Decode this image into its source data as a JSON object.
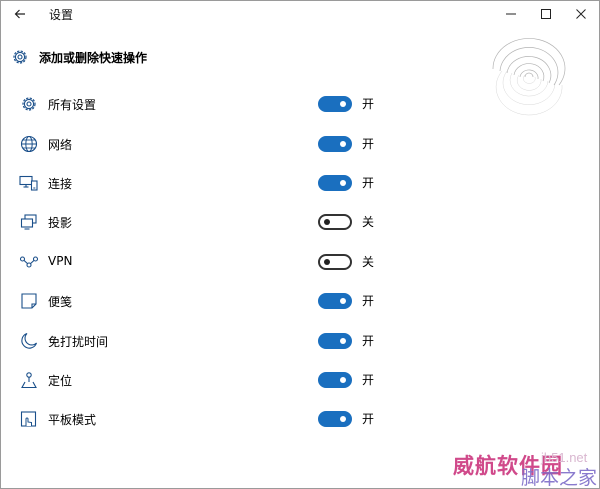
{
  "window": {
    "title": "设置",
    "controls": [
      "minimize-icon",
      "maximize-icon",
      "close-icon"
    ]
  },
  "header": {
    "icon": "gear-icon",
    "title": "添加或删除快速操作"
  },
  "items": [
    {
      "label": "所有设置",
      "state": "开",
      "on": true,
      "icon": "gear-icon"
    },
    {
      "label": "网络",
      "state": "开",
      "on": true,
      "icon": "globe-icon"
    },
    {
      "label": "连接",
      "state": "开",
      "on": true,
      "icon": "devices-icon"
    },
    {
      "label": "投影",
      "state": "关",
      "on": false,
      "icon": "project-icon"
    },
    {
      "label": "VPN",
      "state": "关",
      "on": false,
      "icon": "vpn-icon"
    },
    {
      "label": "便笺",
      "state": "开",
      "on": true,
      "icon": "note-icon"
    },
    {
      "label": "免打扰时间",
      "state": "开",
      "on": true,
      "icon": "moon-icon"
    },
    {
      "label": "定位",
      "state": "开",
      "on": true,
      "icon": "location-icon"
    },
    {
      "label": "平板模式",
      "state": "开",
      "on": true,
      "icon": "tablet-icon"
    }
  ],
  "watermark": {
    "site": "jb51.net",
    "brand": "威航软件园",
    "sub": "脚本之家"
  },
  "colors": {
    "accent": "#1a6fbf",
    "toggle_off_border": "#333333"
  }
}
